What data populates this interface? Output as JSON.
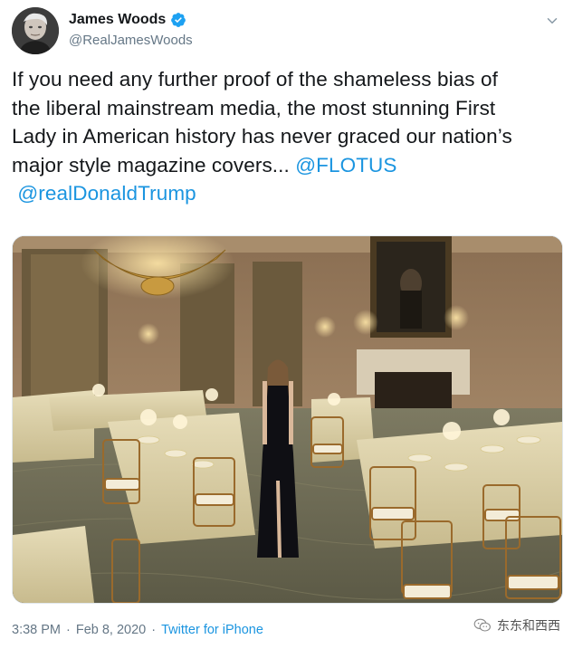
{
  "author": {
    "display_name": "James Woods",
    "handle": "@RealJamesWoods",
    "verified": true
  },
  "tweet": {
    "lines": [
      {
        "text": "If you need any further proof of the shameless bias of"
      },
      {
        "text": "the liberal mainstream media, the most stunning First"
      },
      {
        "text": "Lady in American history has never graced our nation’s"
      },
      {
        "text": "major style magazine covers... ",
        "mention": "@FLOTUS"
      },
      {
        "text": " ",
        "mention": "@realDonaldTrump"
      }
    ]
  },
  "meta": {
    "time": "3:38 PM",
    "separator1": "·",
    "date": "Feb 8, 2020",
    "separator2": "·",
    "source": "Twitter for iPhone"
  },
  "watermark": {
    "text": "东东和西西"
  },
  "icons": {
    "verified": "verified-badge-icon",
    "caret": "chevron-down-icon",
    "watermark": "wechat-logo-icon"
  },
  "colors": {
    "accent": "#1b95e0",
    "verified": "#1da1f2",
    "secondary_text": "#657786",
    "primary_text": "#14171a"
  }
}
